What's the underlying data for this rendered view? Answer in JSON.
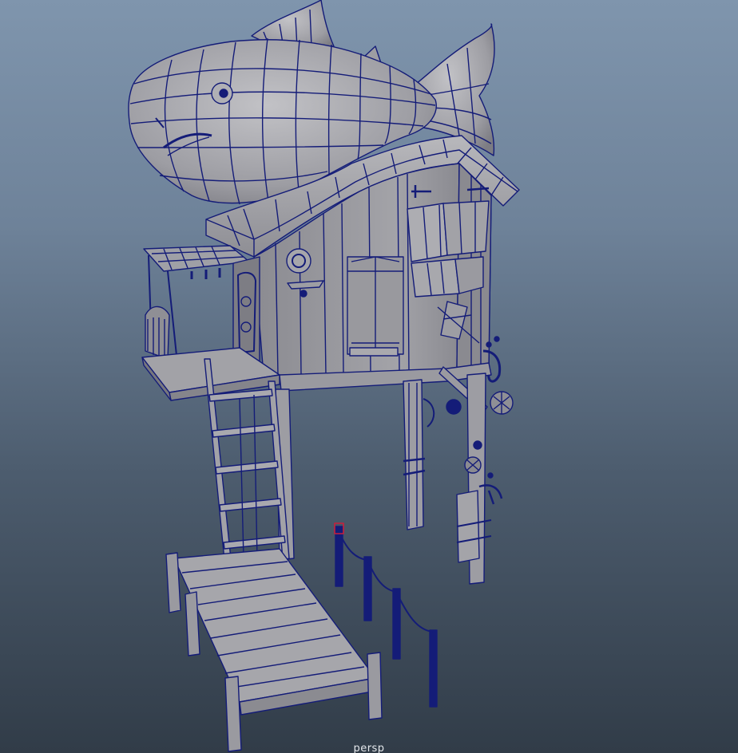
{
  "viewport": {
    "camera_label": "persp",
    "background_top": "#7f95ad",
    "background_bottom": "#313c48",
    "wireframe_color": "#141c78",
    "shaded_color": "#a6a6ab",
    "selection_color": "#c81e3c"
  }
}
